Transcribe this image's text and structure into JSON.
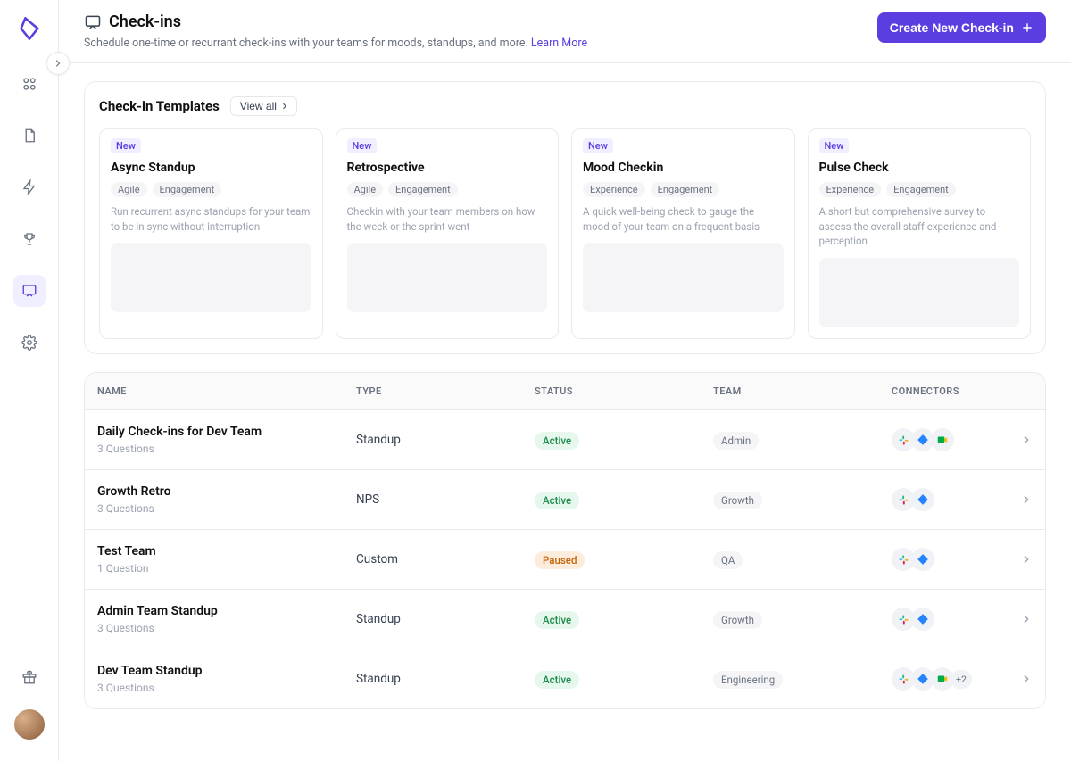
{
  "header": {
    "title": "Check-ins",
    "subtitle": "Schedule one-time or recurrant check-ins with your teams for moods, standups, and more.",
    "learn_more": "Learn More",
    "create_label": "Create New Check-in"
  },
  "templates": {
    "title": "Check-in Templates",
    "view_all": "View all",
    "new_label": "New",
    "cards": [
      {
        "name": "Async Standup",
        "tags": [
          "Agile",
          "Engagement"
        ],
        "desc": "Run recurrent async standups for your team to be in sync without interruption"
      },
      {
        "name": "Retrospective",
        "tags": [
          "Agile",
          "Engagement"
        ],
        "desc": "Checkin with your team members on how the week or the sprint went"
      },
      {
        "name": "Mood Checkin",
        "tags": [
          "Experience",
          "Engagement"
        ],
        "desc": "A quick well-being check to gauge the mood of your team on a frequent basis"
      },
      {
        "name": "Pulse Check",
        "tags": [
          "Experience",
          "Engagement"
        ],
        "desc": "A short but comprehensive survey to assess the overall staff experience and perception"
      }
    ]
  },
  "table": {
    "headers": {
      "name": "NAME",
      "type": "TYPE",
      "status": "STATUS",
      "team": "TEAM",
      "connectors": "CONNECTORS"
    },
    "rows": [
      {
        "name": "Daily Check-ins for Dev Team",
        "sub": "3 Questions",
        "type": "Standup",
        "status": "Active",
        "team": "Admin",
        "connectors": [
          "slack",
          "jira",
          "gmeet"
        ],
        "more": ""
      },
      {
        "name": "Growth Retro",
        "sub": "3 Questions",
        "type": "NPS",
        "status": "Active",
        "team": "Growth",
        "connectors": [
          "slack",
          "jira"
        ],
        "more": ""
      },
      {
        "name": "Test Team",
        "sub": "1 Question",
        "type": "Custom",
        "status": "Paused",
        "team": "QA",
        "connectors": [
          "slack",
          "jira"
        ],
        "more": ""
      },
      {
        "name": "Admin Team Standup",
        "sub": "3 Questions",
        "type": "Standup",
        "status": "Active",
        "team": "Growth",
        "connectors": [
          "slack",
          "jira"
        ],
        "more": ""
      },
      {
        "name": "Dev Team Standup",
        "sub": "3 Questions",
        "type": "Standup",
        "status": "Active",
        "team": "Engineering",
        "connectors": [
          "slack",
          "jira",
          "gmeet"
        ],
        "more": "+2"
      }
    ]
  }
}
